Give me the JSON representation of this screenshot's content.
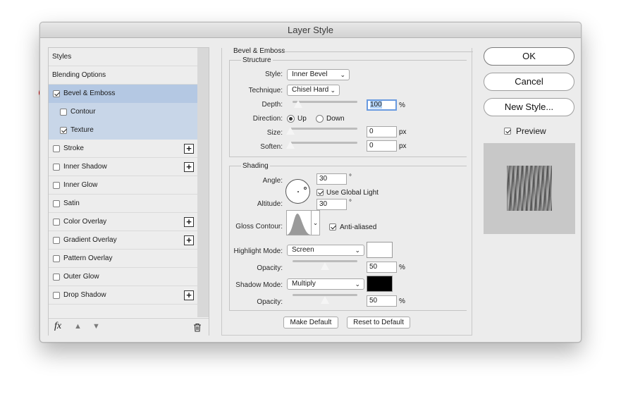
{
  "window": {
    "title": "Layer Style"
  },
  "styles_list": {
    "items": [
      {
        "label": "Styles"
      },
      {
        "label": "Blending Options"
      },
      {
        "label": "Bevel & Emboss",
        "checked": true,
        "selected": true
      },
      {
        "label": "Contour",
        "checked": false
      },
      {
        "label": "Texture",
        "checked": true
      },
      {
        "label": "Stroke",
        "checked": false,
        "addable": true
      },
      {
        "label": "Inner Shadow",
        "checked": false,
        "addable": true
      },
      {
        "label": "Inner Glow",
        "checked": false
      },
      {
        "label": "Satin",
        "checked": false
      },
      {
        "label": "Color Overlay",
        "checked": false,
        "addable": true
      },
      {
        "label": "Gradient Overlay",
        "checked": false,
        "addable": true
      },
      {
        "label": "Pattern Overlay",
        "checked": false
      },
      {
        "label": "Outer Glow",
        "checked": false
      },
      {
        "label": "Drop Shadow",
        "checked": false,
        "addable": true
      }
    ],
    "footer": {
      "fx_label": "fx",
      "icons": [
        "fx-icon",
        "move-up-icon",
        "move-down-icon",
        "trash-icon"
      ]
    }
  },
  "bevel": {
    "section_title": "Bevel & Emboss",
    "structure": {
      "title": "Structure",
      "style_label": "Style:",
      "style_value": "Inner Bevel",
      "technique_label": "Technique:",
      "technique_value": "Chisel Hard",
      "depth_label": "Depth:",
      "depth_value": "100",
      "depth_unit": "%",
      "direction_label": "Direction:",
      "direction_up": "Up",
      "direction_down": "Down",
      "direction_selected": "Up",
      "size_label": "Size:",
      "size_value": "0",
      "size_unit": "px",
      "soften_label": "Soften:",
      "soften_value": "0",
      "soften_unit": "px"
    },
    "shading": {
      "title": "Shading",
      "angle_label": "Angle:",
      "angle_value": "30",
      "angle_unit": "°",
      "global_light_label": "Use Global Light",
      "global_light_checked": true,
      "altitude_label": "Altitude:",
      "altitude_value": "30",
      "altitude_unit": "°",
      "gloss_label": "Gloss Contour:",
      "anti_aliased_label": "Anti-aliased",
      "anti_aliased_checked": true,
      "highlight_label": "Highlight Mode:",
      "highlight_value": "Screen",
      "highlight_color": "#ffffff",
      "highlight_opacity_label": "Opacity:",
      "highlight_opacity_value": "50",
      "highlight_opacity_unit": "%",
      "shadow_label": "Shadow Mode:",
      "shadow_value": "Multiply",
      "shadow_color": "#000000",
      "shadow_opacity_label": "Opacity:",
      "shadow_opacity_value": "50",
      "shadow_opacity_unit": "%"
    },
    "make_default": "Make Default",
    "reset_default": "Reset to Default"
  },
  "actions": {
    "ok": "OK",
    "cancel": "Cancel",
    "new_style": "New Style...",
    "preview_label": "Preview",
    "preview_checked": true
  },
  "colors": {
    "selection": "#b4c8e3",
    "annotation_dot": "#e30000"
  }
}
